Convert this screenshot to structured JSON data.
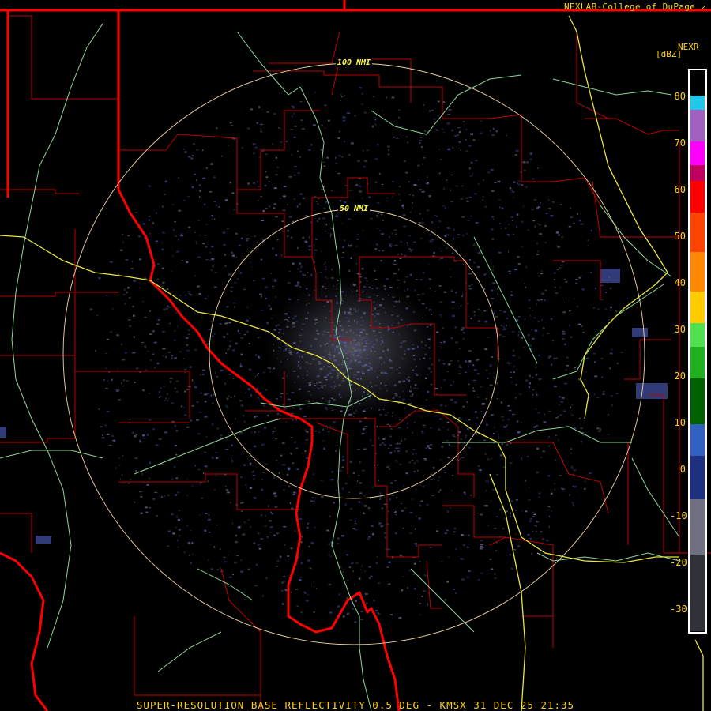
{
  "credit": "NEXLAB-College of DuPage",
  "credit_icon": "external-link-icon",
  "legend": {
    "title": "NEXR",
    "units": "[dBZ]",
    "ticks": [
      "80",
      "70",
      "60",
      "50",
      "40",
      "30",
      "20",
      "10",
      "0",
      "-10",
      "-20",
      "-30"
    ],
    "colors": {
      "cyan": "#20c8e8",
      "magenta": "#ff00ff",
      "red": "#ff0000",
      "orange": "#ff8800",
      "yellow": "#ffff00",
      "green": "#00d000",
      "darkgreen": "#006000",
      "blue": "#3050c0",
      "gray": "#707080"
    }
  },
  "rings": {
    "inner": "50 NMI",
    "outer": "100 NMI"
  },
  "footer": "SUPER-RESOLUTION BASE REFLECTIVITY 0.5 DEG - KMSX 31 DEC 25 21:35"
}
